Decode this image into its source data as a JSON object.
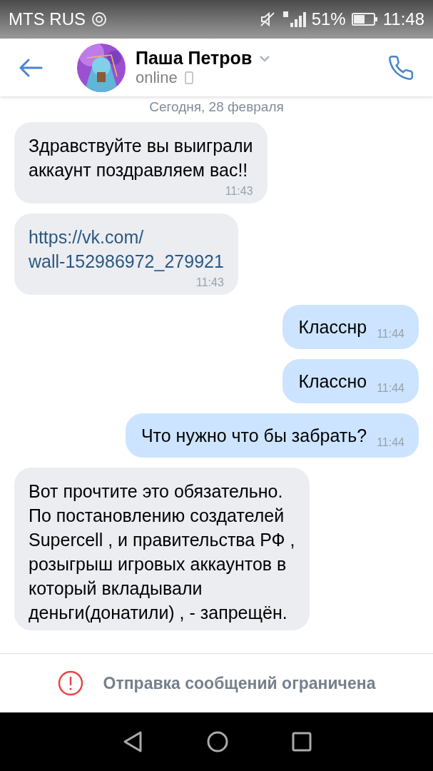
{
  "status_bar": {
    "carrier": "MTS RUS",
    "battery": "51%",
    "time": "11:48"
  },
  "header": {
    "name": "Паша Петров",
    "status": "online"
  },
  "date_divider": "Сегодня, 28 февраля",
  "messages": [
    {
      "kind": "incoming",
      "lines": [
        "Здравствуйте вы выиграли",
        "аккаунт поздравляем вас!!"
      ],
      "time": "11:43"
    },
    {
      "kind": "link",
      "lines": [
        "https://vk.com/",
        "wall-152986972_279921"
      ],
      "time": "11:43"
    },
    {
      "kind": "outgoing",
      "lines": [
        "Класснр"
      ],
      "time": "11:44"
    },
    {
      "kind": "outgoing",
      "lines": [
        "Классно"
      ],
      "time": "11:44"
    },
    {
      "kind": "outgoing",
      "lines": [
        "Что нужно что бы забрать?"
      ],
      "time": "11:44"
    },
    {
      "kind": "incoming",
      "lines": [
        "Вот прочтите это обязательно.",
        "По постановлению создателей",
        "Supercell ,  и правительства РФ ,",
        "розыгрыш игровых аккаунтов в",
        "который вкладывали",
        "деньги(донатили) , - запрещён."
      ]
    }
  ],
  "notice": "Отправка сообщений ограничена"
}
